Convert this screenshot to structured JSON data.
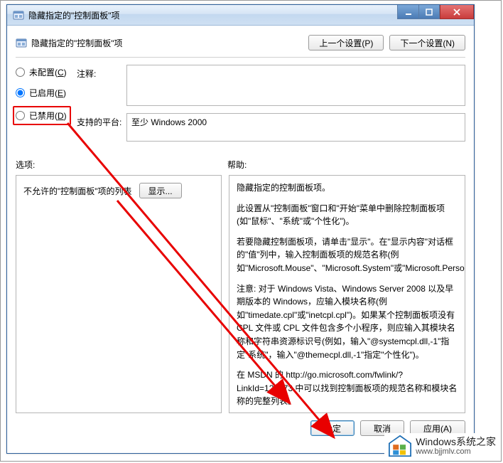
{
  "titlebar": {
    "title": "隐藏指定的\"控制面板\"项"
  },
  "header": {
    "title": "隐藏指定的\"控制面板\"项",
    "prev": "上一个设置(P)",
    "next": "下一个设置(N)"
  },
  "radios": {
    "not_configured": "未配置(",
    "not_configured_u": "C",
    "not_configured_end": ")",
    "enabled": "已启用(",
    "enabled_u": "E",
    "enabled_end": ")",
    "disabled": "已禁用(",
    "disabled_u": "D",
    "disabled_end": ")",
    "selected": "enabled"
  },
  "fields": {
    "comment_label": "注释:",
    "comment_value": "",
    "platform_label": "支持的平台:",
    "platform_value": "至少 Windows 2000"
  },
  "sections": {
    "options": "选项:",
    "help": "帮助:"
  },
  "options": {
    "list_label": "不允许的\"控制面板\"项的列表",
    "show_btn": "显示..."
  },
  "help": {
    "p1": "隐藏指定的控制面板项。",
    "p2": "此设置从\"控制面板\"窗口和\"开始\"菜单中删除控制面板项(如\"鼠标\"、\"系统\"或\"个性化\")。",
    "p3": "若要隐藏控制面板项，请单击\"显示\"。在\"显示内容\"对话框的\"值\"列中，输入控制面板项的规范名称(例如\"Microsoft.Mouse\"、\"Microsoft.System\"或\"Microsoft.Personalization\")。",
    "p4": "注意: 对于 Windows Vista、Windows Server 2008 以及早期版本的 Windows，应输入模块名称(例如\"timedate.cpl\"或\"inetcpl.cpl\")。如果某个控制面板项没有 CPL 文件或 CPL 文件包含多个小程序，则应输入其模块名称和字符串资源标识号(例如，输入\"@systemcpl.dll,-1\"指定\"系统\"，输入\"@themecpl.dll,-1\"指定\"个性化\")。",
    "p5": "在 MSDN 的 http://go.microsoft.com/fwlink/?LinkId=122973 中可以找到控制面板项的规范名称和模块名称的完整列表。"
  },
  "footer": {
    "ok": "确定",
    "cancel": "取消",
    "apply": "应用(A)"
  },
  "watermark": {
    "line1": "Windows系统之家",
    "line2": "www.bjjmlv.com"
  }
}
